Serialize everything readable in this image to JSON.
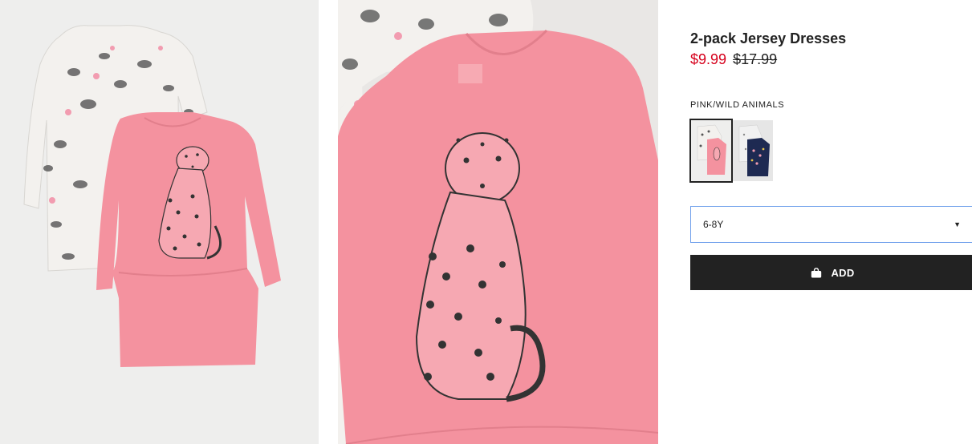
{
  "product": {
    "title": "2-pack Jersey Dresses",
    "price_sale": "$9.99",
    "price_original": "$17.99",
    "color_label": "PINK/WILD ANIMALS"
  },
  "swatches": [
    {
      "name": "pink-wild-animals",
      "selected": true
    },
    {
      "name": "grey-navy",
      "selected": false
    }
  ],
  "size_select": {
    "value": "6-8Y"
  },
  "add_button": {
    "label": "ADD"
  },
  "colors": {
    "sale_price": "#d6001c",
    "button_bg": "#222222",
    "select_border": "#6d9eeb",
    "dress_pink": "#f4929f",
    "print_white": "#f3f1ee",
    "navy": "#1e2a52"
  },
  "icons": {
    "bag": "shopping-bag-icon",
    "chevron": "chevron-down-icon"
  }
}
